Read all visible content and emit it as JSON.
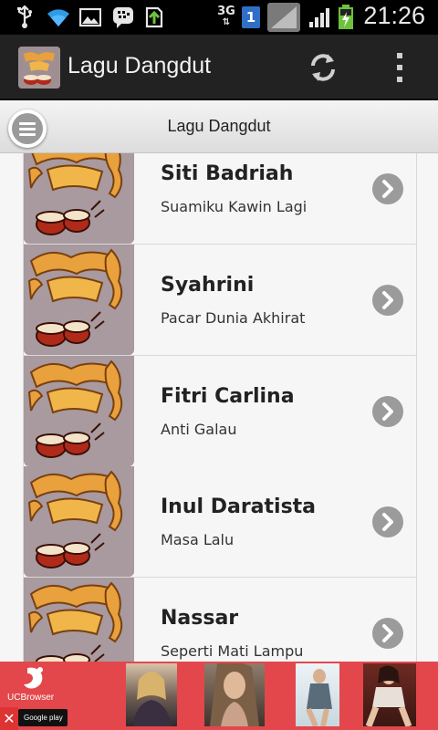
{
  "status_bar": {
    "time": "21:26",
    "network_type": "3G",
    "sim_slot": "1",
    "icons": [
      "usb-icon",
      "wifi-icon",
      "image-icon",
      "bbm-icon",
      "download-icon",
      "signal-icon",
      "battery-icon"
    ]
  },
  "app": {
    "title": "Lagu Dangdut",
    "colors": {
      "actionbar": "#222222",
      "accent": "#e8a13c"
    }
  },
  "subheader": {
    "title": "Lagu Dangdut"
  },
  "list": {
    "items": [
      {
        "artist": "Siti Badriah",
        "song": "Suamiku Kawin Lagi"
      },
      {
        "artist": "Syahrini",
        "song": "Pacar Dunia Akhirat"
      },
      {
        "artist": "Fitri Carlina",
        "song": "Anti Galau"
      },
      {
        "artist": "Inul Daratista",
        "song": "Masa Lalu"
      },
      {
        "artist": "Nassar",
        "song": "Seperti Mati Lampu"
      }
    ]
  },
  "ad": {
    "brand": "UCBrowser",
    "store_label": "Google play",
    "background": "#e3474b"
  }
}
